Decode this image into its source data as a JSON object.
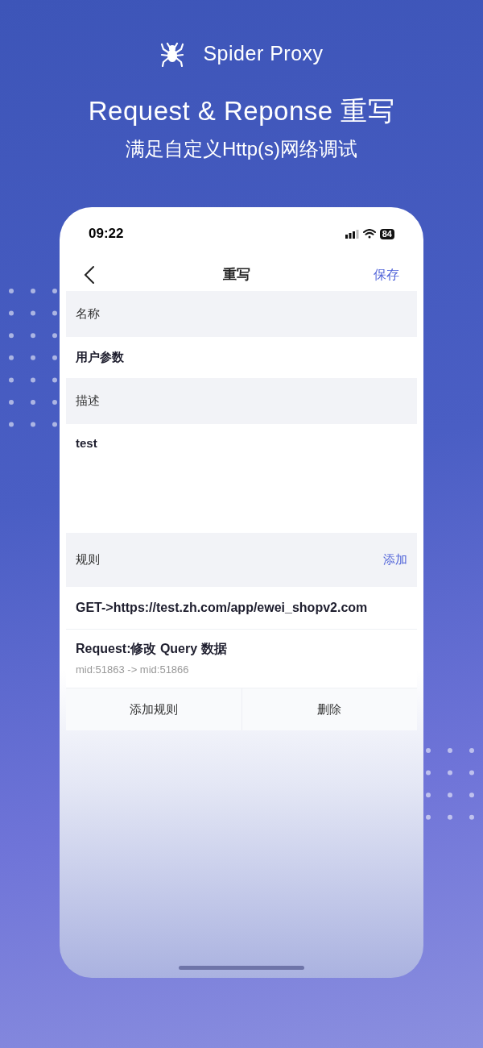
{
  "brand": {
    "name": "Spider Proxy"
  },
  "headline": "Request & Reponse 重写",
  "subheadline": "满足自定义Http(s)网络调试",
  "status_bar": {
    "time": "09:22",
    "battery": "84"
  },
  "nav": {
    "title": "重写",
    "action": "保存"
  },
  "sections": [
    {
      "kind": "header",
      "label": "名称"
    },
    {
      "kind": "value",
      "text": "用户参数"
    },
    {
      "kind": "header",
      "label": "描述"
    },
    {
      "kind": "textarea",
      "text": "test"
    },
    {
      "kind": "header",
      "label": "规则",
      "action": "添加"
    }
  ],
  "rules": [
    {
      "title": "GET->https://test.zh.com/app/ewei_shopv2.com"
    },
    {
      "title": "Request:修改 Query 数据",
      "detail": "mid:51863 -> mid:51866"
    }
  ],
  "buttons": [
    "添加规则",
    "删除"
  ]
}
